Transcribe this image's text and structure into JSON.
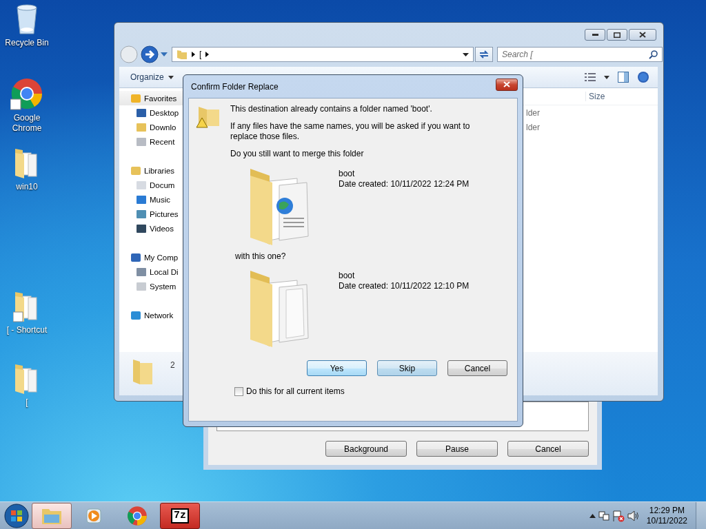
{
  "desktop_icons": [
    {
      "label": "Recycle Bin",
      "kind": "recycle",
      "shortcut": false
    },
    {
      "label": "Google Chrome",
      "kind": "chrome",
      "shortcut": true
    },
    {
      "label": "win10",
      "kind": "folder",
      "shortcut": false
    },
    {
      "label": "[ - Shortcut",
      "kind": "folder",
      "shortcut": true
    },
    {
      "label": "[",
      "kind": "folder",
      "shortcut": false
    }
  ],
  "explorer": {
    "address": "[",
    "search": {
      "placeholder": "Search ["
    },
    "toolbar": [
      "Organize"
    ],
    "navigation": [
      {
        "label": "Favorites",
        "kind": "favorites",
        "children": [
          {
            "label": "Desktop",
            "kind": "desktop"
          },
          {
            "label": "Downlo",
            "kind": "downloads"
          },
          {
            "label": "Recent",
            "kind": "recent"
          }
        ]
      },
      {
        "label": "Libraries",
        "kind": "libraries",
        "children": [
          {
            "label": "Docum",
            "kind": "documents"
          },
          {
            "label": "Music",
            "kind": "music"
          },
          {
            "label": "Pictures",
            "kind": "pictures"
          },
          {
            "label": "Videos",
            "kind": "videos"
          }
        ]
      },
      {
        "label": "My Comp",
        "kind": "computer",
        "children": [
          {
            "label": "Local Di",
            "kind": "drive"
          },
          {
            "label": "System",
            "kind": "disk"
          }
        ]
      },
      {
        "label": "Network",
        "kind": "network"
      }
    ],
    "columns": [
      "Size"
    ],
    "rows": [
      "lder",
      "lder"
    ],
    "details": "2"
  },
  "progress_window": {
    "buttons": [
      "Background",
      "Pause",
      "Cancel"
    ]
  },
  "dialog": {
    "title": "Confirm Folder Replace",
    "message": "This destination already contains a folder named 'boot'.",
    "note": "If any files have the same names, you will be asked if you want to replace those files.",
    "question": "Do you still want to merge this folder",
    "existing": {
      "name": "boot",
      "date": "Date created: 10/11/2022 12:24 PM",
      "kind": "web"
    },
    "separator": "with this one?",
    "incoming": {
      "name": "boot",
      "date": "Date created: 10/11/2022 12:10 PM",
      "kind": "files"
    },
    "buttons": [
      {
        "label": "Yes",
        "hover": true,
        "default": false
      },
      {
        "label": "Skip",
        "hover": false,
        "default": true
      },
      {
        "label": "Cancel",
        "hover": false,
        "default": false
      }
    ],
    "checkbox": {
      "label": "Do this for all current items",
      "checked": false
    }
  },
  "taskbar": {
    "items": [
      {
        "kind": "explorer",
        "open": true
      },
      {
        "kind": "media",
        "open": false
      },
      {
        "kind": "chrome",
        "open": false
      },
      {
        "kind": "sevenzip",
        "open": true,
        "label": "7z"
      }
    ],
    "time": "12:29 PM",
    "date": "10/11/2022"
  }
}
